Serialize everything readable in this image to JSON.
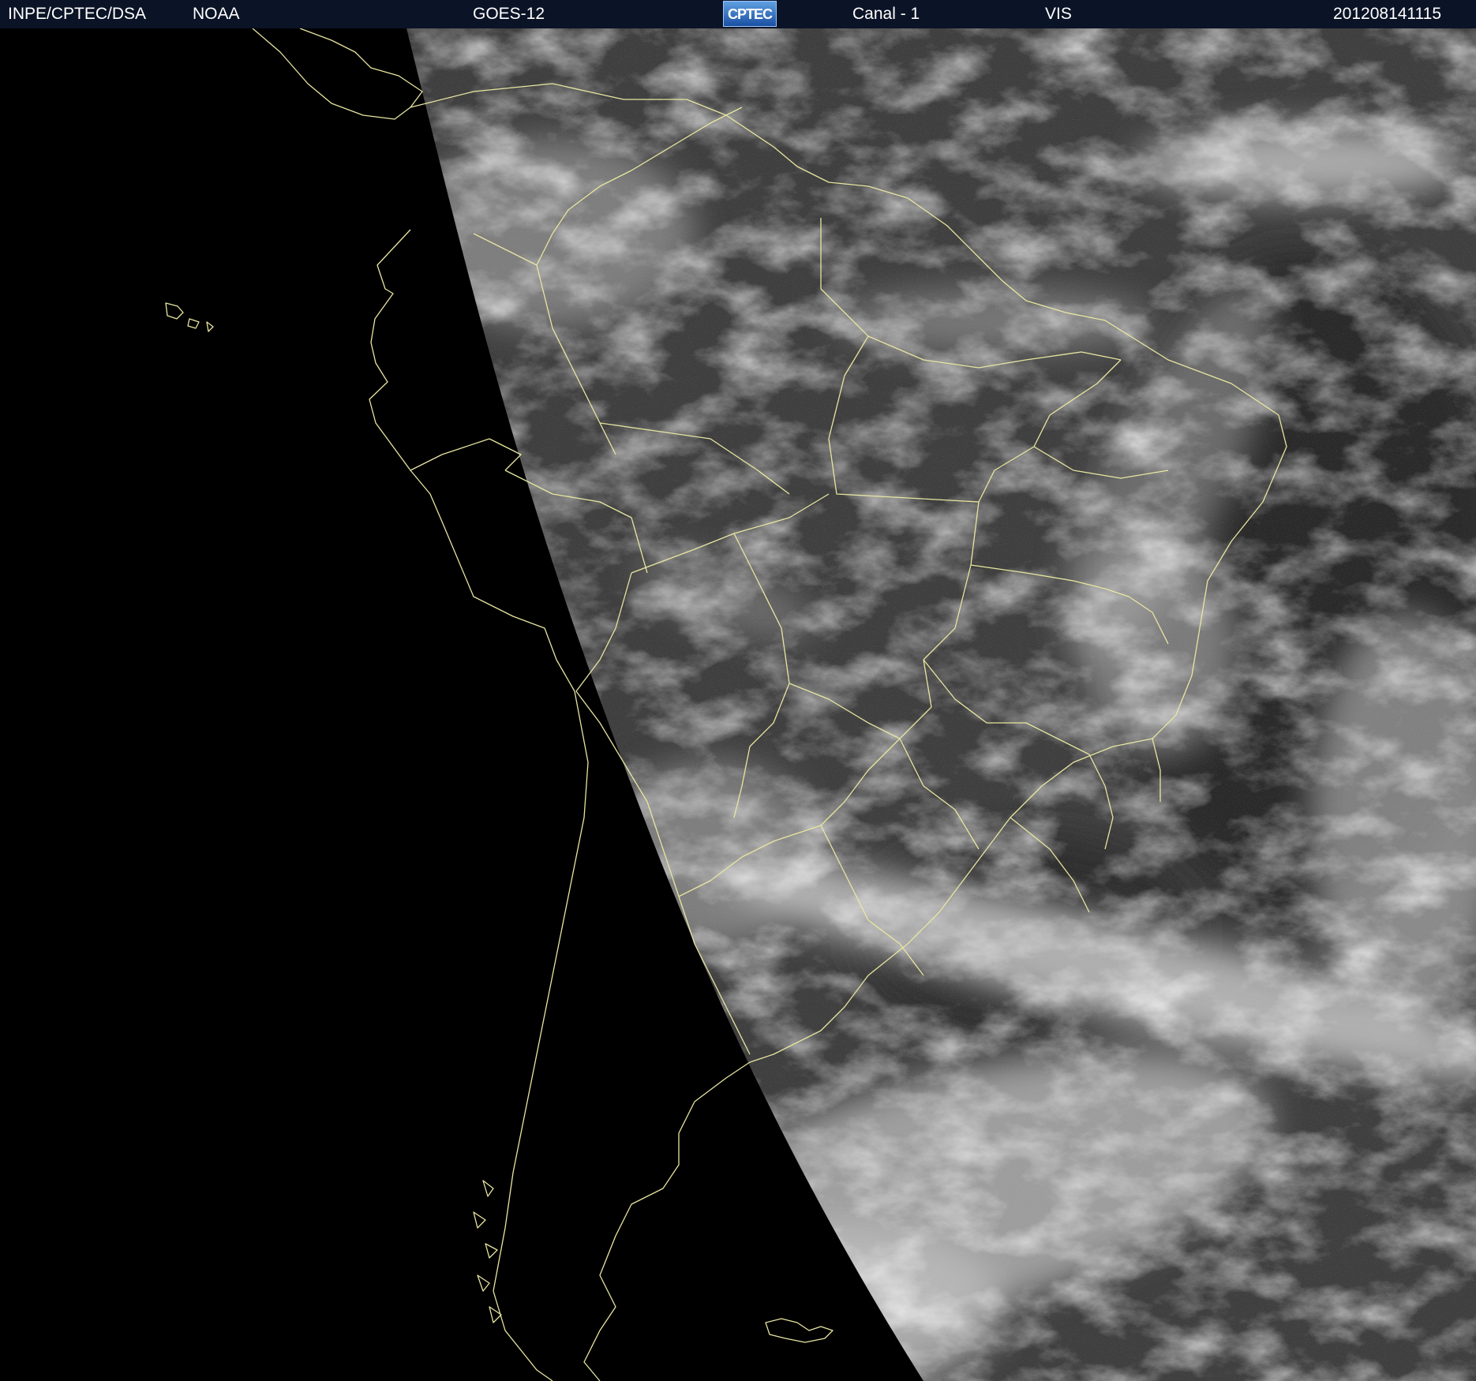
{
  "header": {
    "org": "INPE/CPTEC/DSA",
    "agency": "NOAA",
    "satellite": "GOES-12",
    "logo_text": "CPTEC",
    "channel": "Canal - 1",
    "band": "VIS",
    "timestamp": "201208141115"
  },
  "colors": {
    "header_bg": "#0b1326",
    "border_lines": "#e8e6a0",
    "space": "#000000"
  },
  "image": {
    "type": "satellite visible imagery (grayscale) of South America",
    "icon": "cptec-logo"
  }
}
